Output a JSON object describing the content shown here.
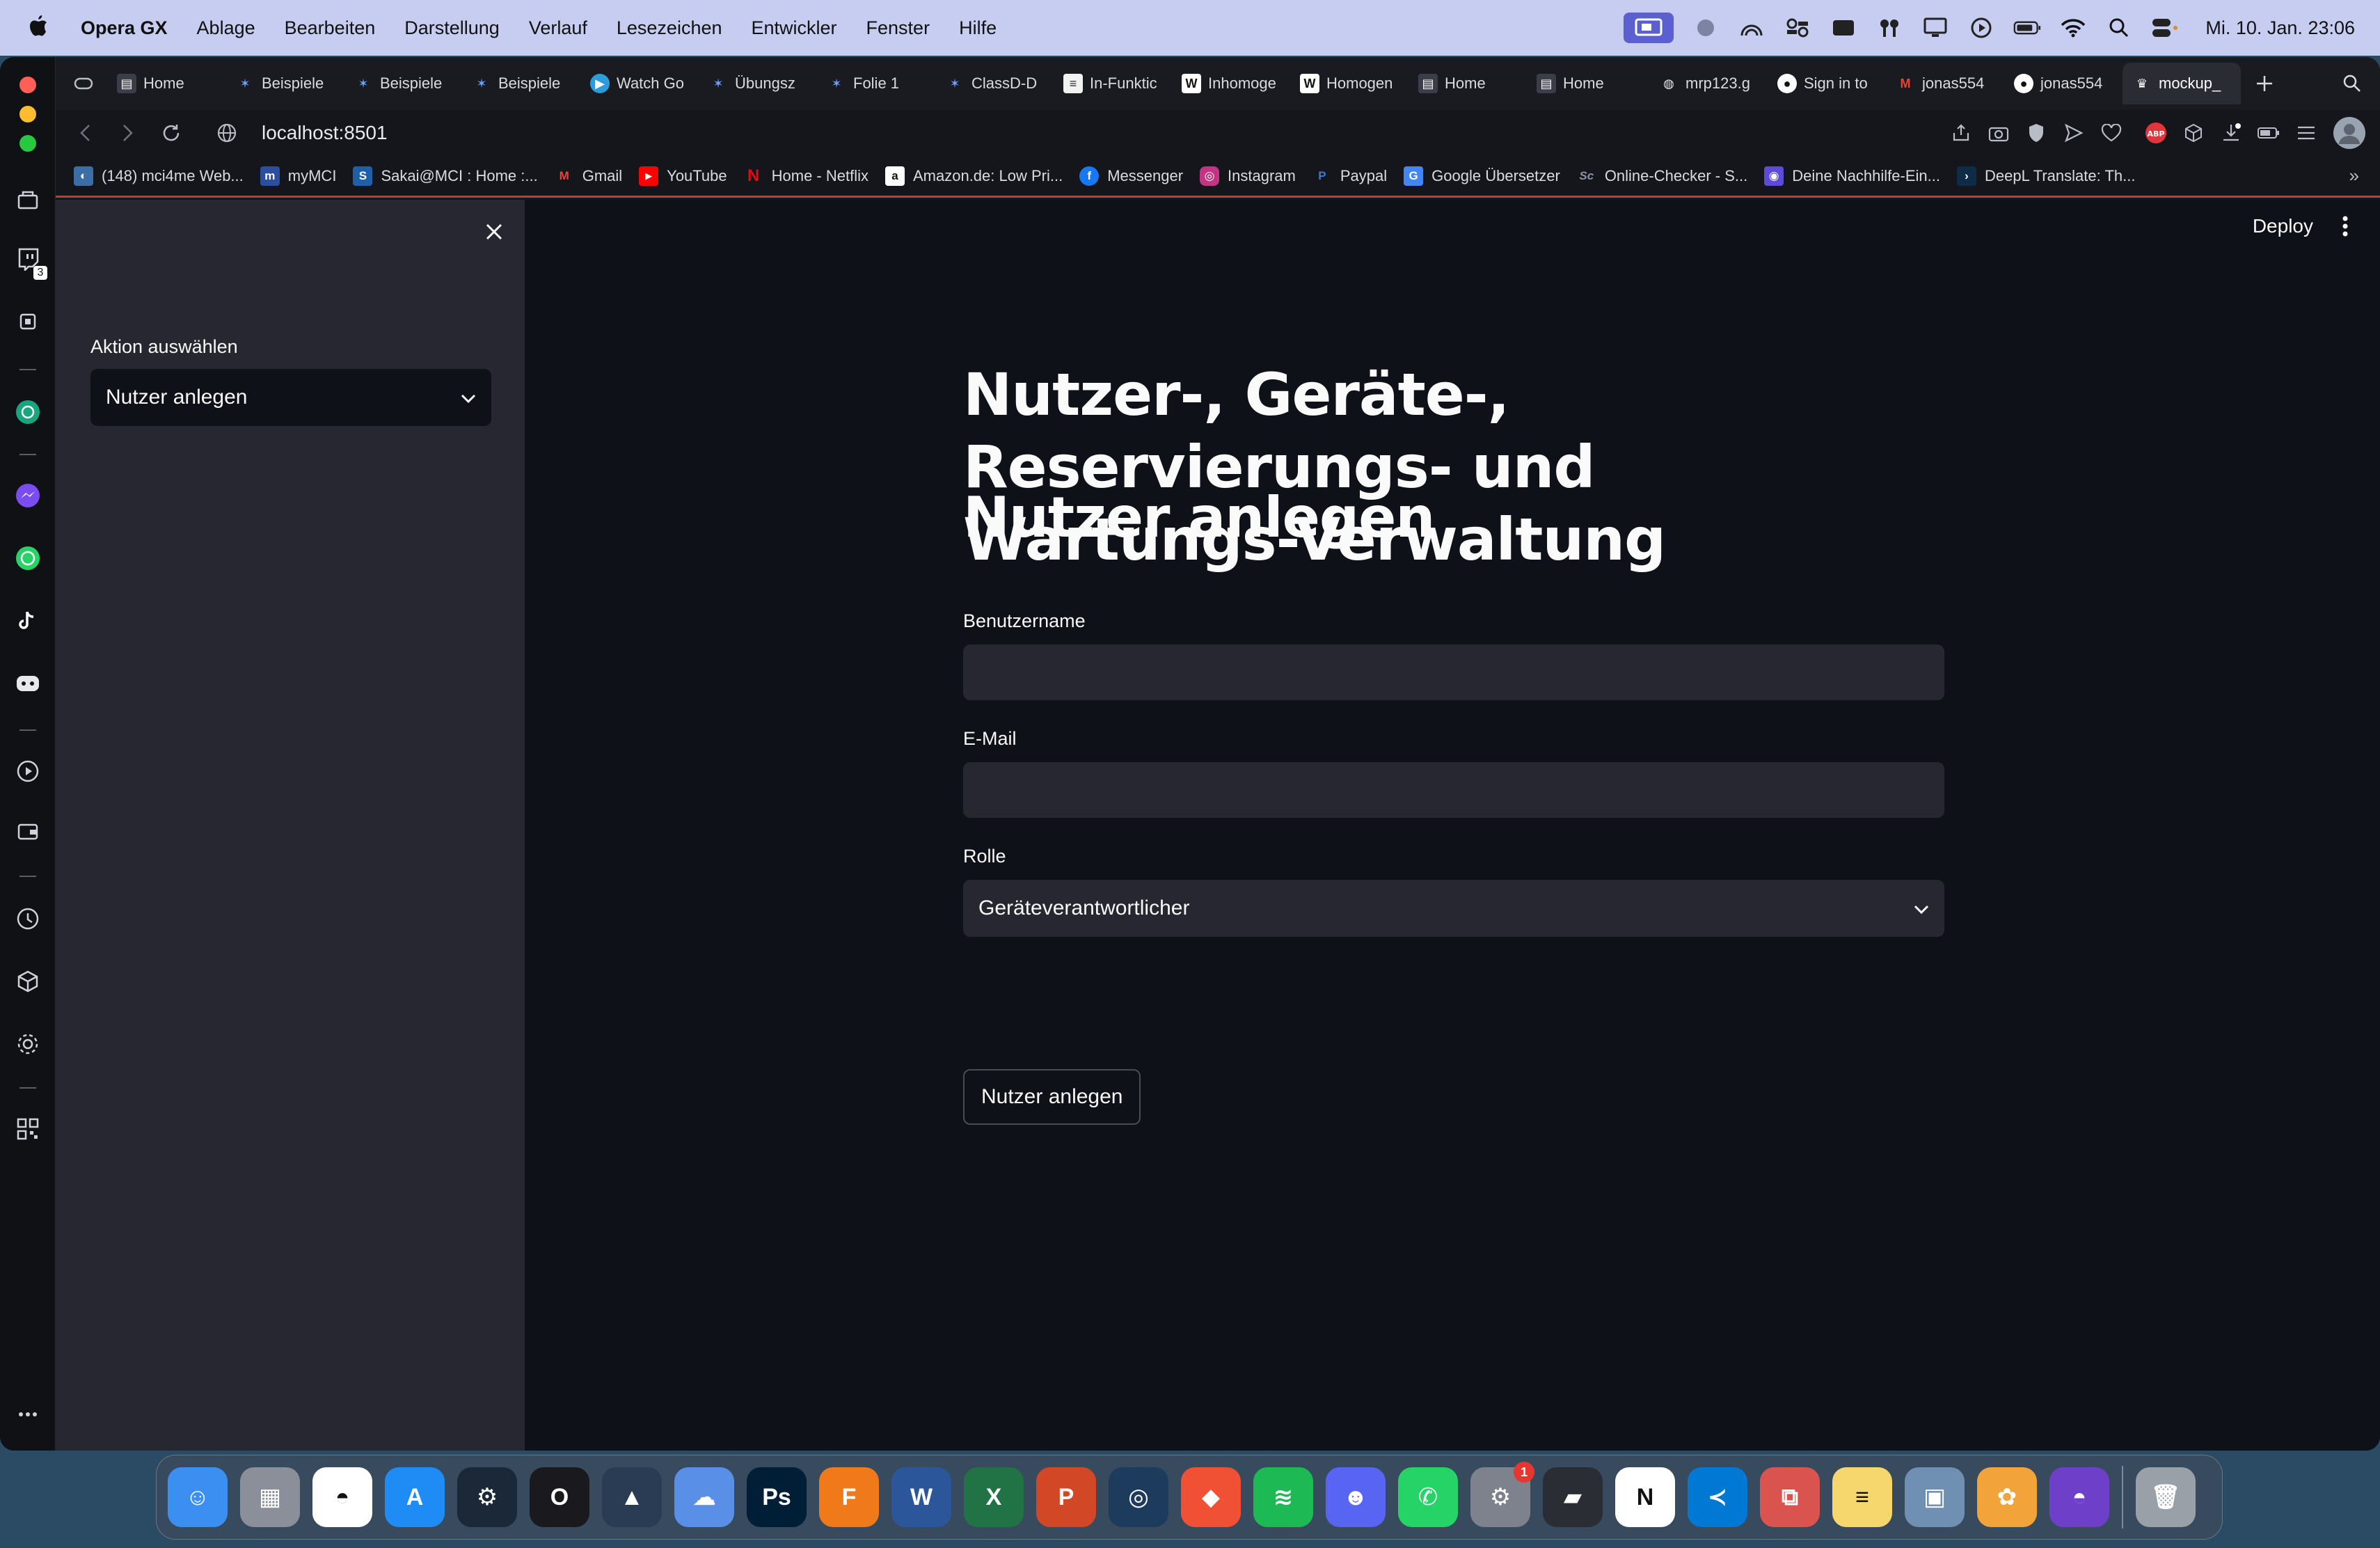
{
  "menubar": {
    "app_name": "Opera GX",
    "menus": [
      "Ablage",
      "Bearbeiten",
      "Darstellung",
      "Verlauf",
      "Lesezeichen",
      "Entwickler",
      "Fenster",
      "Hilfe"
    ],
    "clock": "Mi. 10. Jan.  23:06"
  },
  "rail": {
    "twitch_badge": "3"
  },
  "tabs": [
    {
      "label": "Home",
      "icon": "page-icon"
    },
    {
      "label": "Beispiele",
      "icon": "star-icon"
    },
    {
      "label": "Beispiele",
      "icon": "star-icon"
    },
    {
      "label": "Beispiele",
      "icon": "star-icon"
    },
    {
      "label": "Watch Go",
      "icon": "play-icon"
    },
    {
      "label": "Übungsz",
      "icon": "star-icon"
    },
    {
      "label": "Folie 1",
      "icon": "star-icon"
    },
    {
      "label": "ClassD-D",
      "icon": "star-icon"
    },
    {
      "label": "In-Funktic",
      "icon": "doc-icon"
    },
    {
      "label": "Inhomoge",
      "icon": "wikipedia-icon"
    },
    {
      "label": "Homogen",
      "icon": "wikipedia-icon"
    },
    {
      "label": "Home",
      "icon": "page-icon"
    },
    {
      "label": "Home",
      "icon": "page-icon"
    },
    {
      "label": "mrp123.g",
      "icon": "globe-icon"
    },
    {
      "label": "Sign in to",
      "icon": "github-icon"
    },
    {
      "label": "jonas554",
      "icon": "gmail-icon"
    },
    {
      "label": "jonas554",
      "icon": "github-icon"
    },
    {
      "label": "mockup_",
      "icon": "streamlit-icon"
    }
  ],
  "address": {
    "url": "localhost:8501"
  },
  "bookmarks": [
    {
      "label": "(148) mci4me Web...",
      "color": "#3a6ea5",
      "glyph": "◐"
    },
    {
      "label": "myMCI",
      "color": "#2b4f9e",
      "glyph": "m"
    },
    {
      "label": "Sakai@MCI : Home :...",
      "color": "#1f5fa8",
      "glyph": "S"
    },
    {
      "label": "Gmail",
      "color": "#d93025",
      "glyph": "M"
    },
    {
      "label": "YouTube",
      "color": "#ff0000",
      "glyph": "▶"
    },
    {
      "label": "Home - Netflix",
      "color": "#e50914",
      "glyph": "N"
    },
    {
      "label": "Amazon.de: Low Pri...",
      "color": "#ffffff",
      "glyph": "a"
    },
    {
      "label": "Messenger",
      "color": "#1877f2",
      "glyph": "f"
    },
    {
      "label": "Instagram",
      "color": "#c13584",
      "glyph": "◎"
    },
    {
      "label": "Paypal",
      "color": "#003087",
      "glyph": "P"
    },
    {
      "label": "Google Übersetzer",
      "color": "#4285f4",
      "glyph": "G"
    },
    {
      "label": "Online-Checker - S...",
      "color": "#2b3a55",
      "glyph": "S"
    },
    {
      "label": "Deine Nachhilfe-Ein...",
      "color": "#5b4bd6",
      "glyph": "◉"
    },
    {
      "label": "DeepL Translate: Th...",
      "color": "#0f2b46",
      "glyph": "›"
    }
  ],
  "sidebar": {
    "label": "Aktion auswählen",
    "selected": "Nutzer anlegen"
  },
  "topbar": {
    "deploy": "Deploy"
  },
  "main": {
    "title": "Nutzer-, Geräte-, Reservierungs- und Wartungs-Verwaltung",
    "subtitle": "Nutzer anlegen",
    "username_label": "Benutzername",
    "username_value": "",
    "email_label": "E-Mail",
    "email_value": "",
    "role_label": "Rolle",
    "role_selected": "Geräteverantwortlicher",
    "submit": "Nutzer anlegen"
  },
  "dock": [
    {
      "name": "finder",
      "color": "#3b8ff0",
      "glyph": "☺"
    },
    {
      "name": "launchpad",
      "color": "#8a8f99",
      "glyph": "▦"
    },
    {
      "name": "opera-mini",
      "color": "#ffffff",
      "glyph": "◓"
    },
    {
      "name": "app-store",
      "color": "#1f8cf5",
      "glyph": "A"
    },
    {
      "name": "steam",
      "color": "#1b2838",
      "glyph": "⚙"
    },
    {
      "name": "opera-gx",
      "color": "#1a1a1e",
      "glyph": "O"
    },
    {
      "name": "matlab",
      "color": "#2a3b54",
      "glyph": "▲"
    },
    {
      "name": "creative-cloud",
      "color": "#5a8fe8",
      "glyph": "☁"
    },
    {
      "name": "photoshop",
      "color": "#001e36",
      "glyph": "Ps"
    },
    {
      "name": "fusion-360",
      "color": "#f07a1a",
      "glyph": "F"
    },
    {
      "name": "word",
      "color": "#2b579a",
      "glyph": "W"
    },
    {
      "name": "excel",
      "color": "#217346",
      "glyph": "X"
    },
    {
      "name": "powerpoint",
      "color": "#d24726",
      "glyph": "P"
    },
    {
      "name": "anaconda",
      "color": "#1d3b5c",
      "glyph": "◎"
    },
    {
      "name": "git-app",
      "color": "#f05033",
      "glyph": "◆"
    },
    {
      "name": "spotify",
      "color": "#1db954",
      "glyph": "≋"
    },
    {
      "name": "discord",
      "color": "#5865f2",
      "glyph": "☻"
    },
    {
      "name": "whatsapp",
      "color": "#25d366",
      "glyph": "✆"
    },
    {
      "name": "system-settings",
      "color": "#7d828c",
      "glyph": "⚙",
      "badge": "1"
    },
    {
      "name": "parallels",
      "color": "#2a2d33",
      "glyph": "▰"
    },
    {
      "name": "notion",
      "color": "#ffffff",
      "glyph": "N"
    },
    {
      "name": "vscode",
      "color": "#0078d4",
      "glyph": "≺"
    },
    {
      "name": "remote-desktop",
      "color": "#d9534f",
      "glyph": "⧉"
    },
    {
      "name": "notes",
      "color": "#f5d76e",
      "glyph": "≡"
    },
    {
      "name": "preview",
      "color": "#6f8fb3",
      "glyph": "▣"
    },
    {
      "name": "photos",
      "color": "#f2a33a",
      "glyph": "✿"
    },
    {
      "name": "github-desktop",
      "color": "#6e40c9",
      "glyph": "◓"
    },
    {
      "name": "trash",
      "color": "#9aa0a8",
      "glyph": "🗑"
    }
  ]
}
